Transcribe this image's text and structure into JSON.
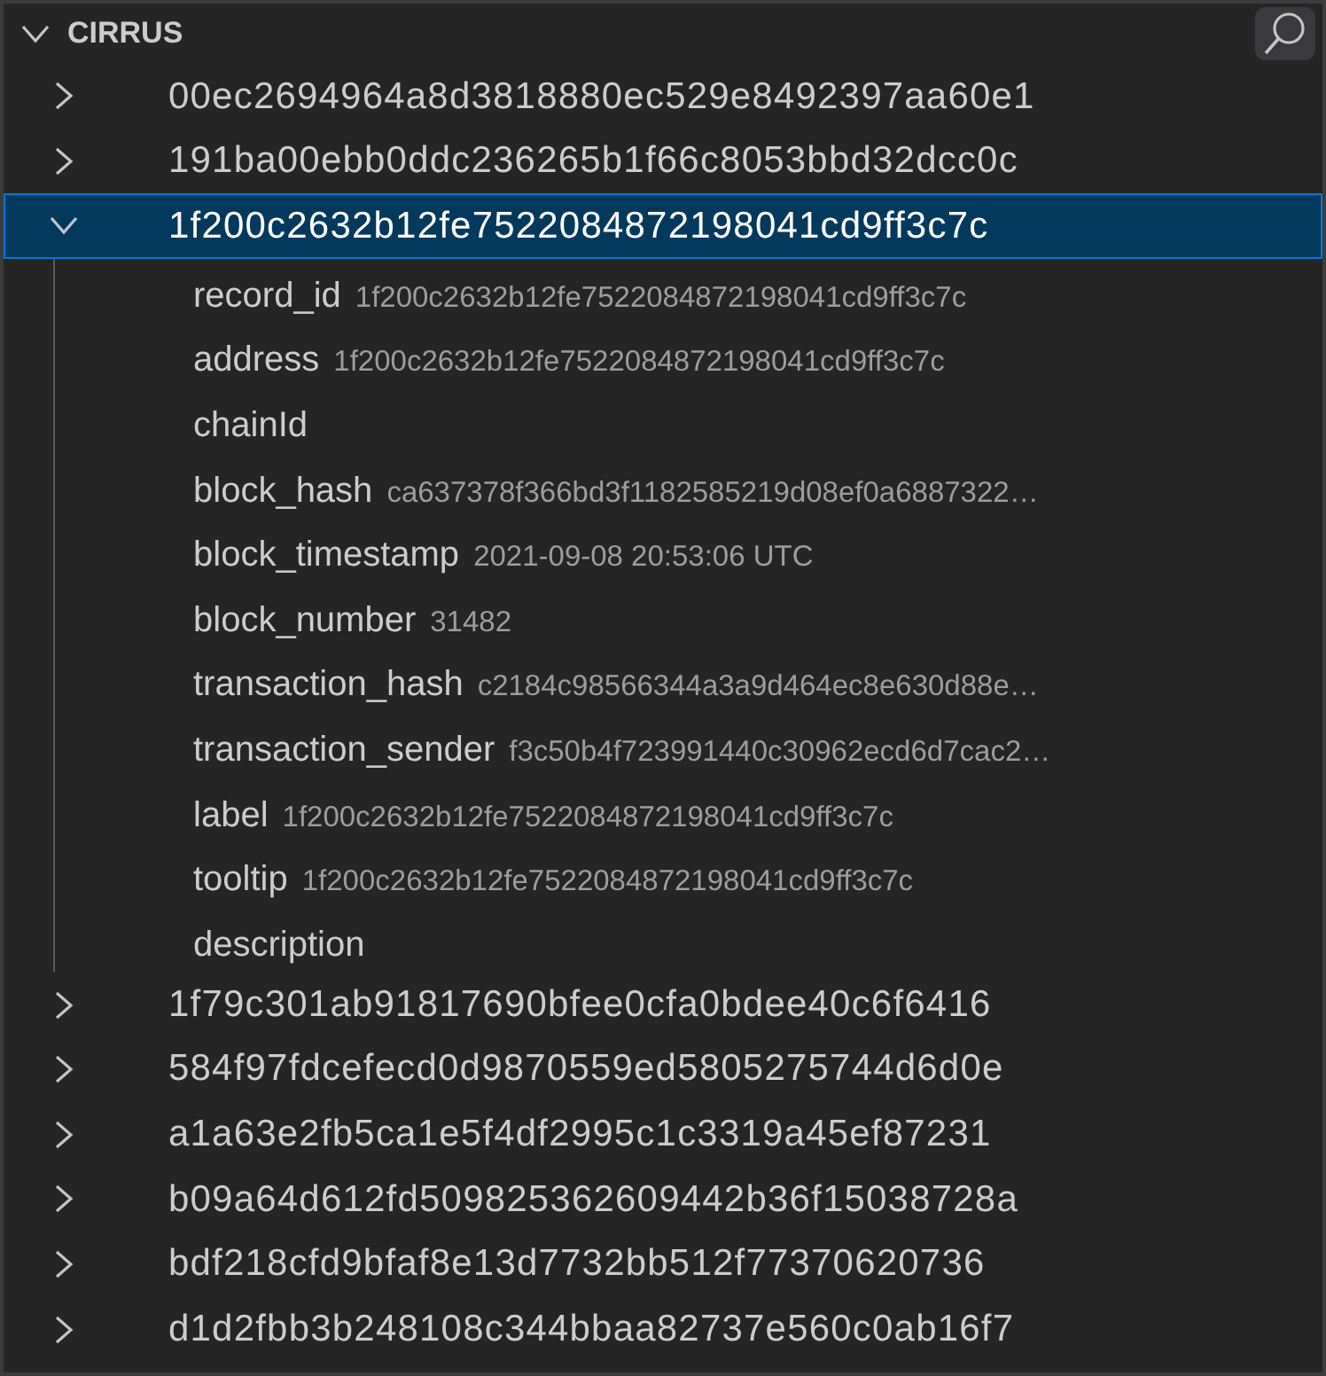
{
  "section": {
    "title": "CIRRUS",
    "expanded": true
  },
  "items": [
    {
      "label": "00ec2694964a8d3818880ec529e8492397aa60e1",
      "expanded": false,
      "selected": false
    },
    {
      "label": "191ba00ebb0ddc236265b1f66c8053bbd32dcc0c",
      "expanded": false,
      "selected": false
    },
    {
      "label": "1f200c2632b12fe7522084872198041cd9ff3c7c",
      "expanded": true,
      "selected": true,
      "children": [
        {
          "key": "record_id",
          "value": "1f200c2632b12fe7522084872198041cd9ff3c7c"
        },
        {
          "key": "address",
          "value": "1f200c2632b12fe7522084872198041cd9ff3c7c"
        },
        {
          "key": "chainId"
        },
        {
          "key": "block_hash",
          "value": "ca637378f366bd3f1182585219d08ef0a6887322…"
        },
        {
          "key": "block_timestamp",
          "value": "2021-09-08 20:53:06 UTC"
        },
        {
          "key": "block_number",
          "value": "31482"
        },
        {
          "key": "transaction_hash",
          "value": "c2184c98566344a3a9d464ec8e630d88e…"
        },
        {
          "key": "transaction_sender",
          "value": "f3c50b4f723991440c30962ecd6d7cac2…"
        },
        {
          "key": "label",
          "value": "1f200c2632b12fe7522084872198041cd9ff3c7c"
        },
        {
          "key": "tooltip",
          "value": "1f200c2632b12fe7522084872198041cd9ff3c7c"
        },
        {
          "key": "description"
        }
      ]
    },
    {
      "label": "1f79c301ab91817690bfee0cfa0bdee40c6f6416",
      "expanded": false,
      "selected": false
    },
    {
      "label": "584f97fdcefecd0d9870559ed5805275744d6d0e",
      "expanded": false,
      "selected": false
    },
    {
      "label": "a1a63e2fb5ca1e5f4df2995c1c3319a45ef87231",
      "expanded": false,
      "selected": false
    },
    {
      "label": "b09a64d612fd509825362609442b36f15038728a",
      "expanded": false,
      "selected": false
    },
    {
      "label": "bdf218cfd9bfaf8e13d7732bb512f77370620736",
      "expanded": false,
      "selected": false
    },
    {
      "label": "d1d2fbb3b248108c344bbaa82737e560c0ab16f7",
      "expanded": false,
      "selected": false
    }
  ]
}
